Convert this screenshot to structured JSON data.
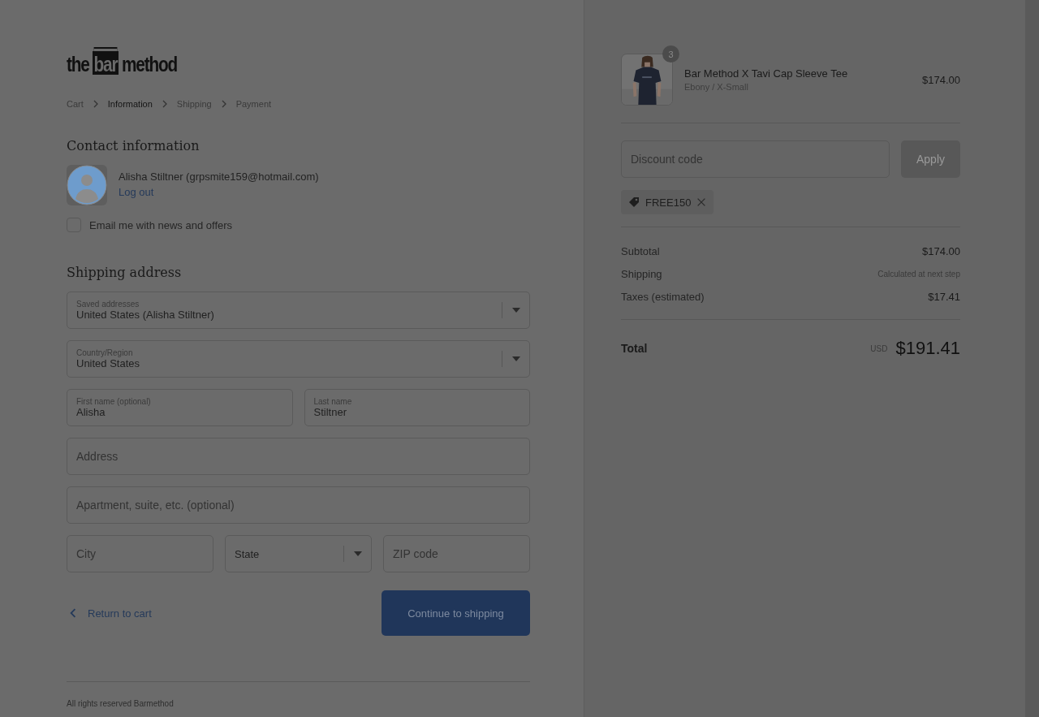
{
  "logo": {
    "words": [
      "the",
      "bar",
      "method"
    ]
  },
  "breadcrumbs": [
    {
      "label": "Cart",
      "selected": false
    },
    {
      "label": "Information",
      "selected": true
    },
    {
      "label": "Shipping",
      "selected": false
    },
    {
      "label": "Payment",
      "selected": false
    }
  ],
  "contact": {
    "heading": "Contact information",
    "account": "Alisha Stiltner (grpsmite159@hotmail.com)",
    "logout": "Log out",
    "newsletter": {
      "label": "Email me with news and offers",
      "checked": false
    }
  },
  "shipping": {
    "heading": "Shipping address",
    "rows": [
      [
        {
          "kind": "select",
          "label": "Saved addresses",
          "value": "United States (Alisha Stiltner)"
        }
      ],
      [
        {
          "kind": "select",
          "label": "Country/Region",
          "value": "United States"
        }
      ],
      [
        {
          "kind": "text",
          "label": "First name (optional)",
          "value": "Alisha"
        },
        {
          "kind": "text",
          "label": "Last name",
          "value": "Stiltner"
        }
      ],
      [
        {
          "kind": "text",
          "placeholder": "Address"
        }
      ],
      [
        {
          "kind": "text",
          "placeholder": "Apartment, suite, etc. (optional)"
        }
      ],
      [
        {
          "kind": "text",
          "placeholder": "City"
        },
        {
          "kind": "select",
          "value": "State"
        },
        {
          "kind": "text",
          "placeholder": "ZIP code"
        }
      ]
    ]
  },
  "actions": {
    "back": "Return to cart",
    "continue": "Continue to shipping"
  },
  "footer": "All rights reserved Barmethod",
  "summary": {
    "product": {
      "kind": "picture",
      "quantity": "3",
      "name": "Bar Method X Tavi Cap Sleeve Tee",
      "variant": "Ebony / X-Small",
      "price": "$174.00"
    },
    "discount": {
      "placeholder": "Discount code",
      "button": "Apply",
      "code": "FREE150"
    },
    "lines": [
      {
        "label": "Subtotal",
        "value": "$174.00",
        "kind": "amount"
      },
      {
        "label": "Shipping",
        "value": "Calculated at next step",
        "kind": "note"
      },
      {
        "label": "Taxes (estimated)",
        "value": "$17.41",
        "kind": "amount"
      }
    ],
    "total": {
      "label": "Total",
      "currency": "USD",
      "value": "$191.41"
    }
  }
}
